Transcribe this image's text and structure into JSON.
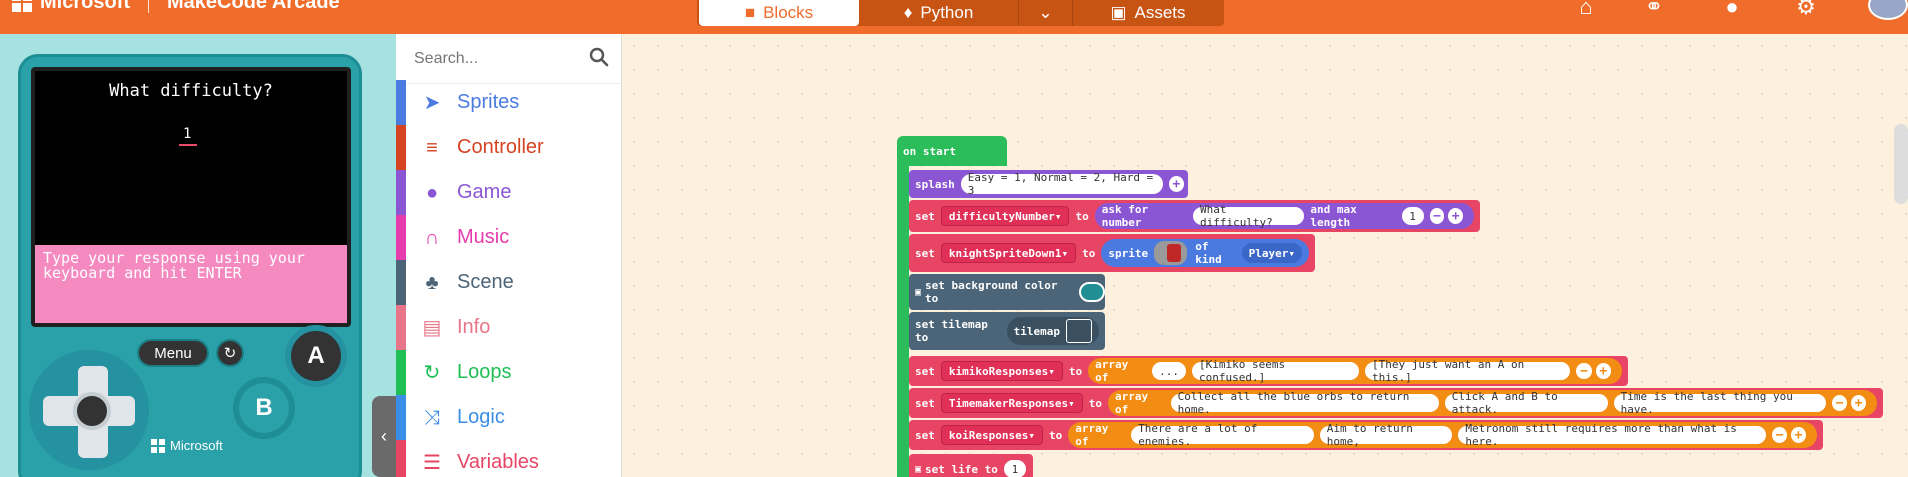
{
  "header": {
    "brand": "Microsoft",
    "product": "MakeCode Arcade",
    "tabs": {
      "blocks": "Blocks",
      "python": "Python",
      "assets": "Assets"
    },
    "accent_color": "#f06c2a"
  },
  "simulator": {
    "question": "What difficulty?",
    "answer": "1",
    "prompt": "Type your response using your keyboard and hit ENTER",
    "menu_label": "Menu",
    "button_a": "A",
    "button_b": "B",
    "footer_brand": "Microsoft"
  },
  "toolbox": {
    "search_placeholder": "Search...",
    "categories": [
      {
        "label": "Sprites",
        "icon": "paper-plane-icon",
        "color": "#4b7be0"
      },
      {
        "label": "Controller",
        "icon": "gamepad-icon",
        "color": "#d54322"
      },
      {
        "label": "Game",
        "icon": "circle-icon",
        "color": "#8b56d4"
      },
      {
        "label": "Music",
        "icon": "headphones-icon",
        "color": "#e63cae"
      },
      {
        "label": "Scene",
        "icon": "tree-icon",
        "color": "#4b6478"
      },
      {
        "label": "Info",
        "icon": "id-card-icon",
        "color": "#e87589"
      },
      {
        "label": "Loops",
        "icon": "loop-icon",
        "color": "#20bf55"
      },
      {
        "label": "Logic",
        "icon": "shuffle-icon",
        "color": "#3a8ee6"
      },
      {
        "label": "Variables",
        "icon": "list-icon",
        "color": "#e84565"
      }
    ]
  },
  "workspace": {
    "on_start": "on start",
    "splash": {
      "kw": "splash",
      "text": "Easy = 1, Normal = 2, Hard = 3"
    },
    "set_difficulty": {
      "set": "set",
      "var": "difficultyNumber",
      "to": "to",
      "ask": "ask for number",
      "question": "What difficulty?",
      "maxlen_label": "and max length",
      "maxlen": "1"
    },
    "set_knight": {
      "set": "set",
      "var": "knightSpriteDown1",
      "to": "to",
      "sprite": "sprite",
      "of_kind": "of kind",
      "kind": "Player"
    },
    "bg_color": "set background color to",
    "tilemap": {
      "label": "set tilemap to",
      "value": "tilemap"
    },
    "kimiko": {
      "set": "set",
      "var": "kimikoResponses",
      "to": "to",
      "array": "array of",
      "items": [
        "...",
        "[Kimiko seems confused.]",
        "[They just want an A on this.]"
      ]
    },
    "timemaker": {
      "set": "set",
      "var": "TimemakerResponses",
      "to": "to",
      "array": "array of",
      "items": [
        "Collect all the blue orbs to return home.",
        "Click A and B to attack.",
        "Time is the last thing you have."
      ]
    },
    "koi": {
      "set": "set",
      "var": "koiResponses",
      "to": "to",
      "array": "array of",
      "items": [
        "There are a lot of enemies.",
        "Aim to return home,",
        "Metronom still requires more than what is here."
      ]
    },
    "life": {
      "label": "set life to",
      "value": "1"
    }
  }
}
